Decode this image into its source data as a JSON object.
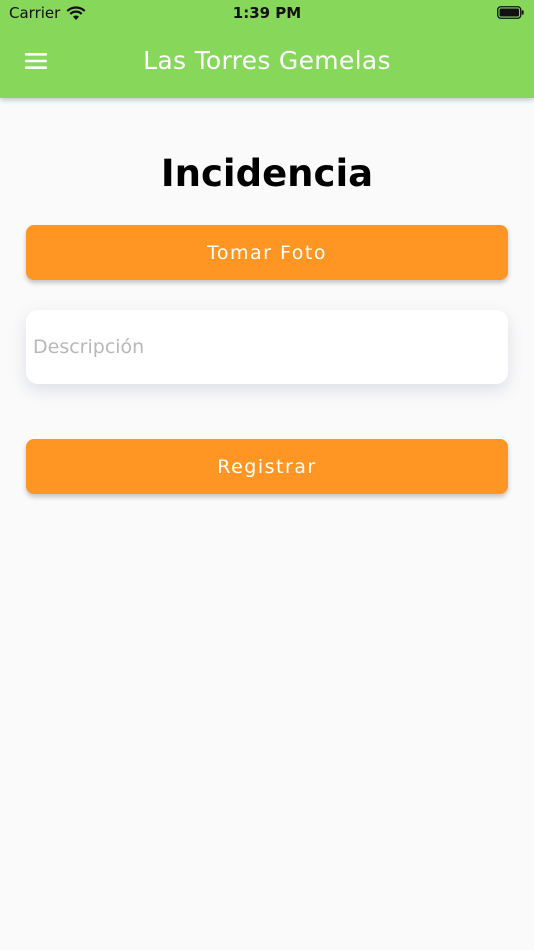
{
  "status_bar": {
    "carrier": "Carrier",
    "time": "1:39 PM"
  },
  "app_bar": {
    "title": "Las Torres Gemelas",
    "menu_icon": "hamburger-menu-icon",
    "background": "#86d75a"
  },
  "main": {
    "title": "Incidencia",
    "take_photo_label": "Tomar Foto",
    "description_placeholder": "Descripción",
    "description_value": "",
    "register_label": "Registrar",
    "button_color": "#ff9522"
  }
}
